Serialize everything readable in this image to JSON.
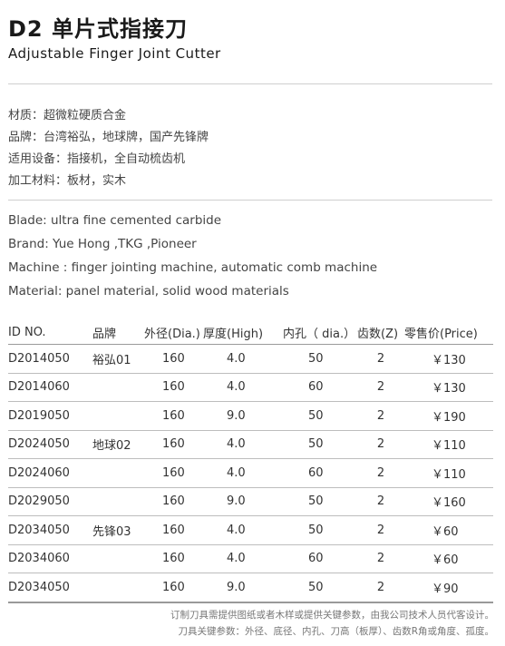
{
  "header": {
    "title_cn": "D2 单片式指接刀",
    "title_en": "Adjustable Finger Joint Cutter"
  },
  "specs_cn": [
    "材质：超微粒硬质合金",
    "品牌：台湾裕弘，地球牌，国产先锋牌",
    "适用设备：指接机，全自动梳齿机",
    "加工材料：板材，实木"
  ],
  "specs_en": [
    "Blade: ultra fine cemented carbide",
    "Brand: Yue Hong ,TKG ,Pioneer",
    "Machine : finger jointing machine, automatic comb machine",
    "Material: panel material, solid wood materials"
  ],
  "table": {
    "headers": [
      "ID NO.",
      "品牌",
      "外径(Dia.)",
      "厚度(High)",
      "内孔（ dia.）",
      "齿数(Z)",
      "零售价(Price)"
    ],
    "rows": [
      [
        "D2014050",
        "裕弘01",
        "160",
        "4.0",
        "50",
        "2",
        "￥130"
      ],
      [
        "D2014060",
        "",
        "160",
        "4.0",
        "60",
        "2",
        "￥130"
      ],
      [
        "D2019050",
        "",
        "160",
        "9.0",
        "50",
        "2",
        "￥190"
      ],
      [
        "D2024050",
        "地球02",
        "160",
        "4.0",
        "50",
        "2",
        "￥110"
      ],
      [
        "D2024060",
        "",
        "160",
        "4.0",
        "60",
        "2",
        "￥110"
      ],
      [
        "D2029050",
        "",
        "160",
        "9.0",
        "50",
        "2",
        "￥160"
      ],
      [
        "D2034050",
        "先锋03",
        "160",
        "4.0",
        "50",
        "2",
        "￥60"
      ],
      [
        "D2034060",
        "",
        "160",
        "4.0",
        "60",
        "2",
        "￥60"
      ],
      [
        "D2034050",
        "",
        "160",
        "9.0",
        "50",
        "2",
        "￥90"
      ]
    ]
  },
  "notes": [
    "订制刀具需提供图纸或者木样或提供关键参数，由我公司技术人员代客设计。",
    "刀具关键参数：外径、底径、内孔、刀高（板厚）、齿数R角或角度、孤度。"
  ]
}
